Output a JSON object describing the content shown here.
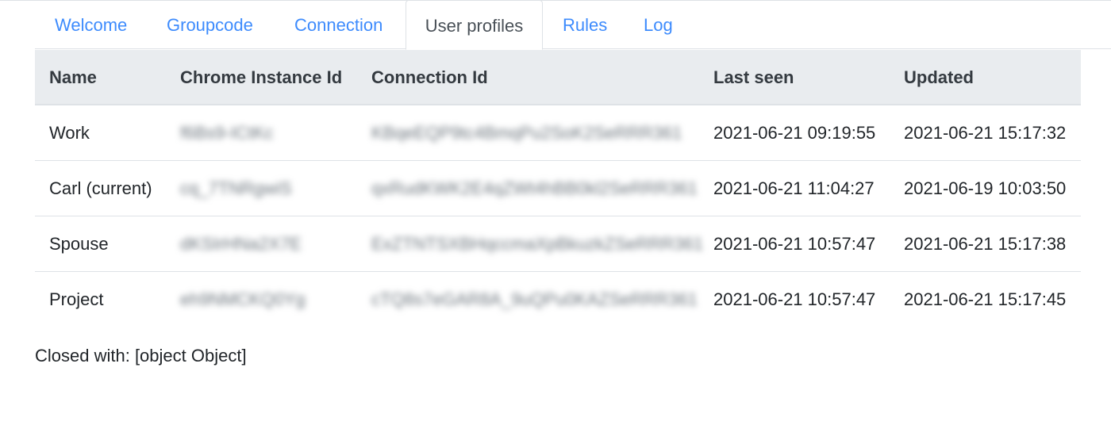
{
  "tabs": [
    {
      "label": "Welcome"
    },
    {
      "label": "Groupcode"
    },
    {
      "label": "Connection"
    },
    {
      "label": "User profiles"
    },
    {
      "label": "Rules"
    },
    {
      "label": "Log"
    }
  ],
  "active_tab": "User profiles",
  "table": {
    "headers": [
      "Name",
      "Chrome Instance Id",
      "Connection Id",
      "Last seen",
      "Updated"
    ],
    "rows": [
      {
        "name": "Work",
        "chrome_id": "f6Bs9-ICtKc",
        "connection_id": "KBqeEQP9tc4BmqPu2SoK2SeRRR361",
        "last_seen": "2021-06-21 09:19:55",
        "updated": "2021-06-21 15:17:32"
      },
      {
        "name": "Carl (current)",
        "chrome_id": "cq_7TNRgwiS",
        "connection_id": "qxRudKWK2E4qZWt4hBB0kl2SeRRR361",
        "last_seen": "2021-06-21 11:04:27",
        "updated": "2021-06-19 10:03:50"
      },
      {
        "name": "Spouse",
        "chrome_id": "dKSIrHNa2X7E",
        "connection_id": "ExZTNTSXBHqccmaXpBkuzkZSeRRR361",
        "last_seen": "2021-06-21 10:57:47",
        "updated": "2021-06-21 15:17:38"
      },
      {
        "name": "Project",
        "chrome_id": "eh9NMCKQ0Yg",
        "connection_id": "cTQ8s7eGAR8A_9uQPu0KAZSeRRR361",
        "last_seen": "2021-06-21 10:57:47",
        "updated": "2021-06-21 15:17:45"
      }
    ]
  },
  "status_text": "Closed with: [object Object]",
  "colors": {
    "link": "#3d8bfd",
    "active_tab_text": "#495057",
    "header_bg": "#e9ecef",
    "border": "#dee2e6"
  }
}
